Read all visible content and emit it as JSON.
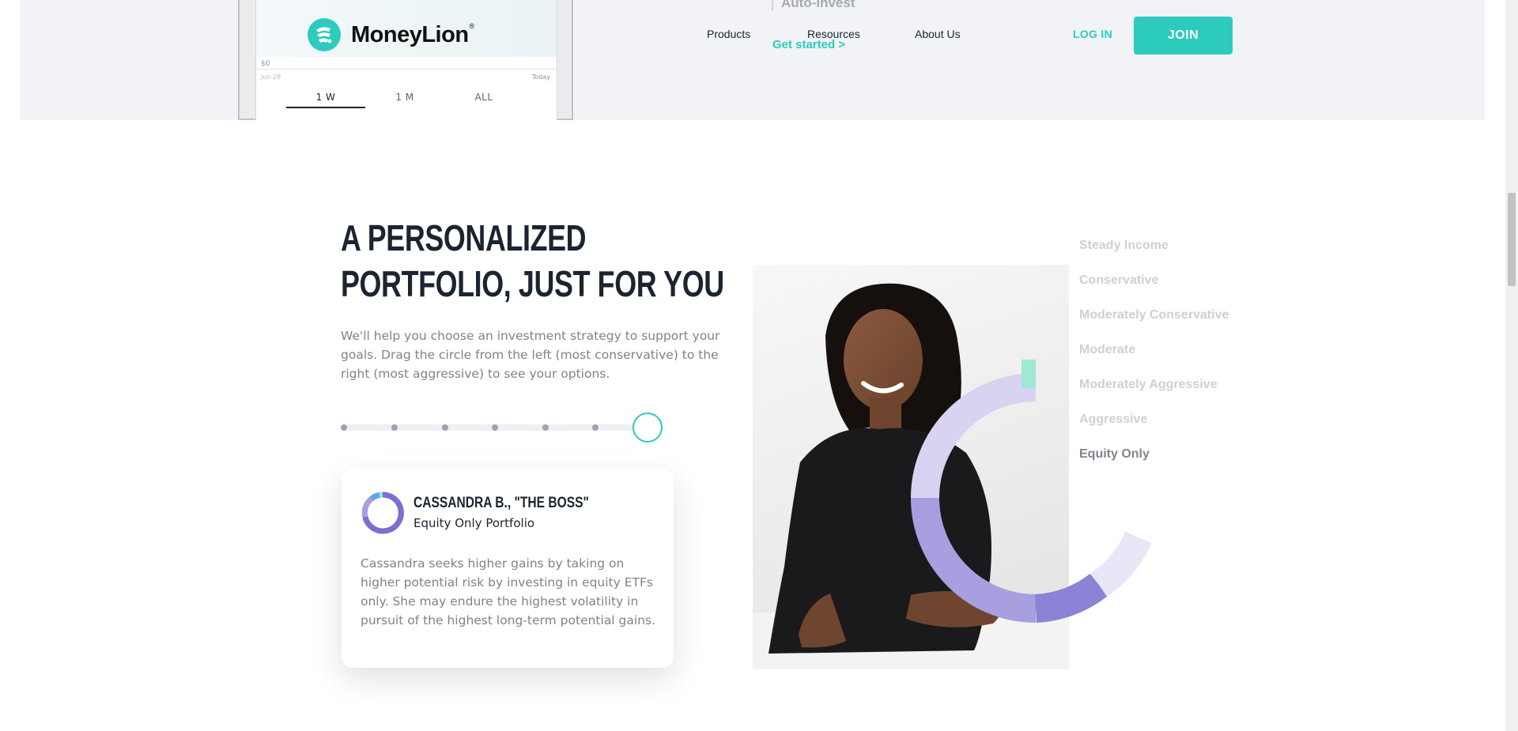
{
  "header": {
    "brand_name": "MoneyLion",
    "brand_mark": "®",
    "auto_invest_label": "Auto-Invest",
    "get_started_link": "Get started >",
    "nav": {
      "products": "Products",
      "resources": "Resources",
      "about": "About Us"
    },
    "login_label": "LOG IN",
    "join_label": "JOIN"
  },
  "phone_chart": {
    "y_axis_zero": "$0",
    "x_start": "Jun 28",
    "x_end": "Today",
    "range_tabs": [
      "1 W",
      "1 M",
      "ALL"
    ],
    "active_range": "1 W"
  },
  "section": {
    "headline_line1": "A PERSONALIZED",
    "headline_line2": "PORTFOLIO, JUST FOR YOU",
    "description": "We'll help you choose an investment strategy to support your goals. Drag the circle from the left (most conservative) to the right (most aggressive) to see your options."
  },
  "slider": {
    "position_index": 6,
    "total_steps": 7
  },
  "card": {
    "name": "CASSANDRA B., \"THE BOSS\"",
    "portfolio": "Equity Only Portfolio",
    "text": "Cassandra seeks higher gains by taking on higher potential risk by investing in equity ETFs only. She may endure the highest volatility in pursuit of the highest long-term potential gains."
  },
  "strategies": [
    "Steady Income",
    "Conservative",
    "Moderately Conservative",
    "Moderate",
    "Moderately Aggressive",
    "Aggressive",
    "Equity Only"
  ],
  "active_strategy": "Equity Only",
  "colors": {
    "accent": "#2ccbbd",
    "navy": "#1b2430",
    "donut_light": "#c9c5ec",
    "donut_mid": "#9f97dc",
    "donut_dark": "#7a70cf"
  }
}
